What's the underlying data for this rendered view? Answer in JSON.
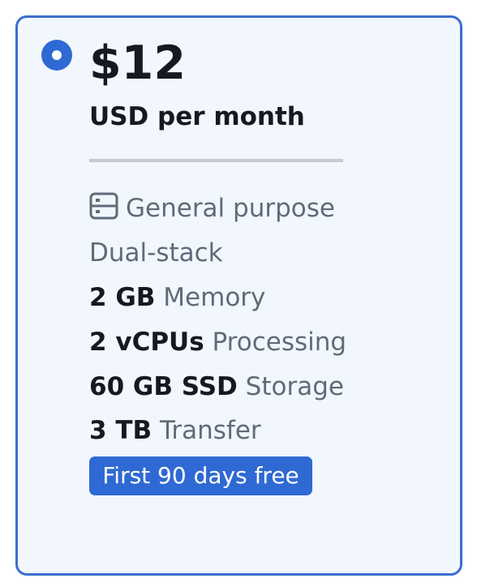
{
  "plan": {
    "selected": true,
    "price": "$12",
    "price_unit": "USD per month",
    "category": "General purpose",
    "category_icon": "server-icon",
    "network": "Dual-stack",
    "memory": {
      "value": "2 GB",
      "label": "Memory"
    },
    "processing": {
      "value": "2 vCPUs",
      "label": "Processing"
    },
    "storage": {
      "value": "60 GB SSD",
      "label": "Storage"
    },
    "transfer": {
      "value": "3 TB",
      "label": "Transfer"
    },
    "badge": "First 90 days free"
  },
  "colors": {
    "accent": "#2f69d3",
    "card_background": "#f1f7fd",
    "card_border": "#3a6fd0",
    "primary_text": "#16191f",
    "secondary_text": "#5f6b7a",
    "divider": "#c6c9cf"
  }
}
